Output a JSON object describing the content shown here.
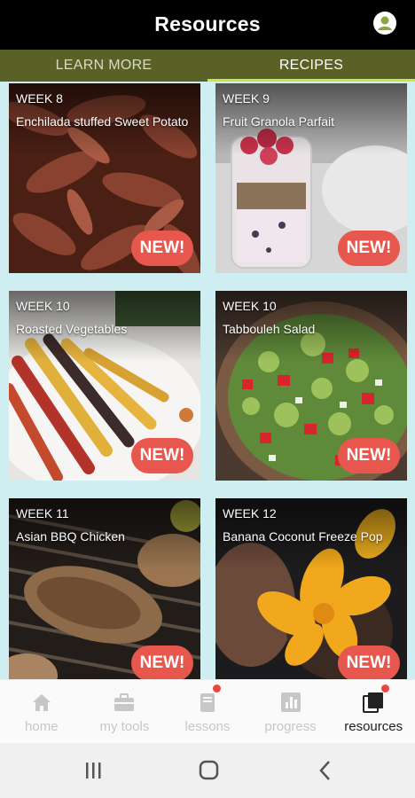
{
  "header": {
    "title": "Resources",
    "profile_icon": "account-circle-icon"
  },
  "tabs": [
    {
      "label": "LEARN MORE",
      "selected": false
    },
    {
      "label": "RECIPES",
      "selected": true
    }
  ],
  "recipes": [
    {
      "week": "WEEK 8",
      "title": "Enchilada stuffed Sweet Potato",
      "badge": "NEW!"
    },
    {
      "week": "WEEK 9",
      "title": "Fruit Granola Parfait",
      "badge": "NEW!"
    },
    {
      "week": "WEEK 10",
      "title": "Roasted Vegetables",
      "badge": "NEW!"
    },
    {
      "week": "WEEK 10",
      "title": "Tabbouleh Salad",
      "badge": "NEW!"
    },
    {
      "week": "WEEK 11",
      "title": "Asian BBQ Chicken",
      "badge": "NEW!"
    },
    {
      "week": "WEEK 12",
      "title": "Banana Coconut Freeze Pop",
      "badge": "NEW!"
    }
  ],
  "bottom_nav": [
    {
      "label": "home",
      "icon": "home-icon",
      "active": false,
      "dot": false
    },
    {
      "label": "my tools",
      "icon": "toolbox-icon",
      "active": false,
      "dot": false
    },
    {
      "label": "lessons",
      "icon": "book-icon",
      "active": false,
      "dot": true
    },
    {
      "label": "progress",
      "icon": "bar-chart-icon",
      "active": false,
      "dot": false
    },
    {
      "label": "resources",
      "icon": "resources-icon",
      "active": true,
      "dot": true
    }
  ],
  "system_nav": [
    "recent-apps-icon",
    "home-circle-icon",
    "back-icon"
  ],
  "colors": {
    "tab_bar": "#5a6127",
    "tab_indicator": "#c8e64a",
    "content_bg": "#cfeef2",
    "badge": "#e8574d",
    "notification_dot": "#e8463e"
  }
}
